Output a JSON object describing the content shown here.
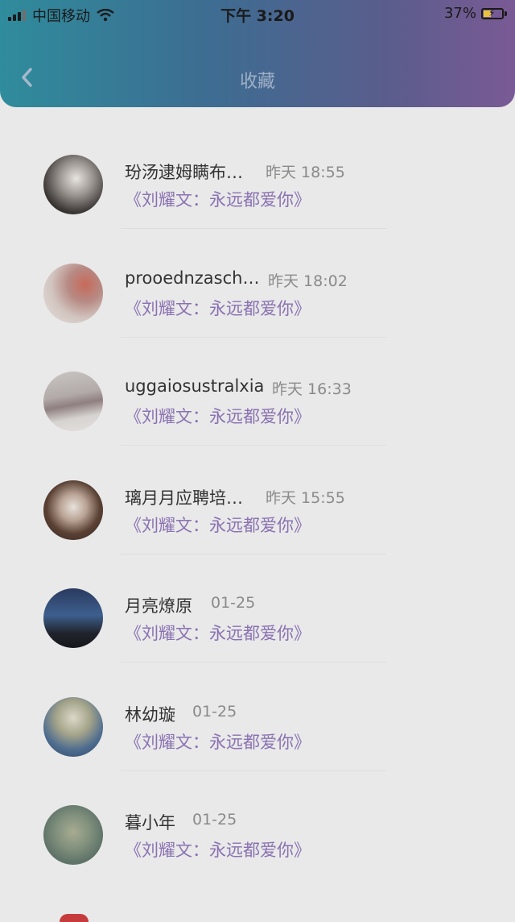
{
  "status_bar": {
    "carrier": "中国移动",
    "time": "下午 3:20",
    "battery": "37%"
  },
  "header": {
    "title": "收藏"
  },
  "favorites": [
    {
      "name": "玢汤逮姆瞒布…",
      "time": "昨天 18:55",
      "quote": "《刘耀文：永远都爱你》"
    },
    {
      "name": "prooednzasch…",
      "time": "昨天 18:02",
      "quote": "《刘耀文：永远都爱你》"
    },
    {
      "name": "uggaiosustralxia",
      "time": "昨天 16:33",
      "quote": "《刘耀文：永远都爱你》"
    },
    {
      "name": "璃月月应聘培…",
      "time": "昨天 15:55",
      "quote": "《刘耀文：永远都爱你》"
    },
    {
      "name": "月亮燎原",
      "time": "01-25",
      "quote": "《刘耀文：永远都爱你》"
    },
    {
      "name": "林幼璇",
      "time": "01-25",
      "quote": "《刘耀文：永远都爱你》"
    },
    {
      "name": "暮小年",
      "time": "01-25",
      "quote": "《刘耀文：永远都爱你》"
    }
  ],
  "colors": {
    "header_gradient_start": "#2f8c9c",
    "header_gradient_end": "#7a5a94",
    "quote_text": "#8a72b2",
    "background": "#e9e9e9"
  }
}
